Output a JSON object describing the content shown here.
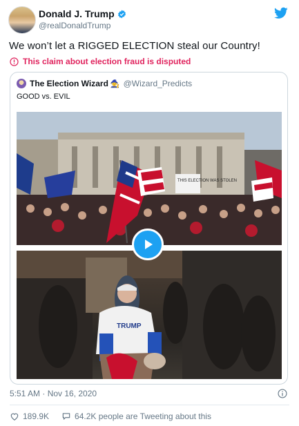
{
  "author": {
    "display_name": "Donald J. Trump",
    "handle": "@realDonaldTrump",
    "verified": true
  },
  "tweet_text": "We won’t let a RIGGED ELECTION steal our Country!",
  "disputed_label": "This claim about election fraud is disputed",
  "quoted_tweet": {
    "display_name": "The Election Wizard",
    "badge_emoji": "🧙",
    "handle": "@Wizard_Predicts",
    "text": "GOOD vs. EVIL",
    "sign_text": "THIS ELECTION WAS STOLEN",
    "shirt_text": "TRUMP"
  },
  "timestamp": "5:51 AM · Nov 16, 2020",
  "stats": {
    "likes": "189.9K",
    "talking": "64.2K people are Tweeting about this"
  },
  "colors": {
    "twitter_blue": "#1da1f2",
    "disputed_red": "#e0245e",
    "secondary_text": "#657786"
  },
  "icons": {
    "verified": "verified-badge-icon",
    "brand": "twitter-bird-icon",
    "disputed": "exclamation-circle-icon",
    "play": "play-icon",
    "info": "info-icon",
    "like": "heart-icon",
    "talk": "speech-bubble-icon"
  }
}
